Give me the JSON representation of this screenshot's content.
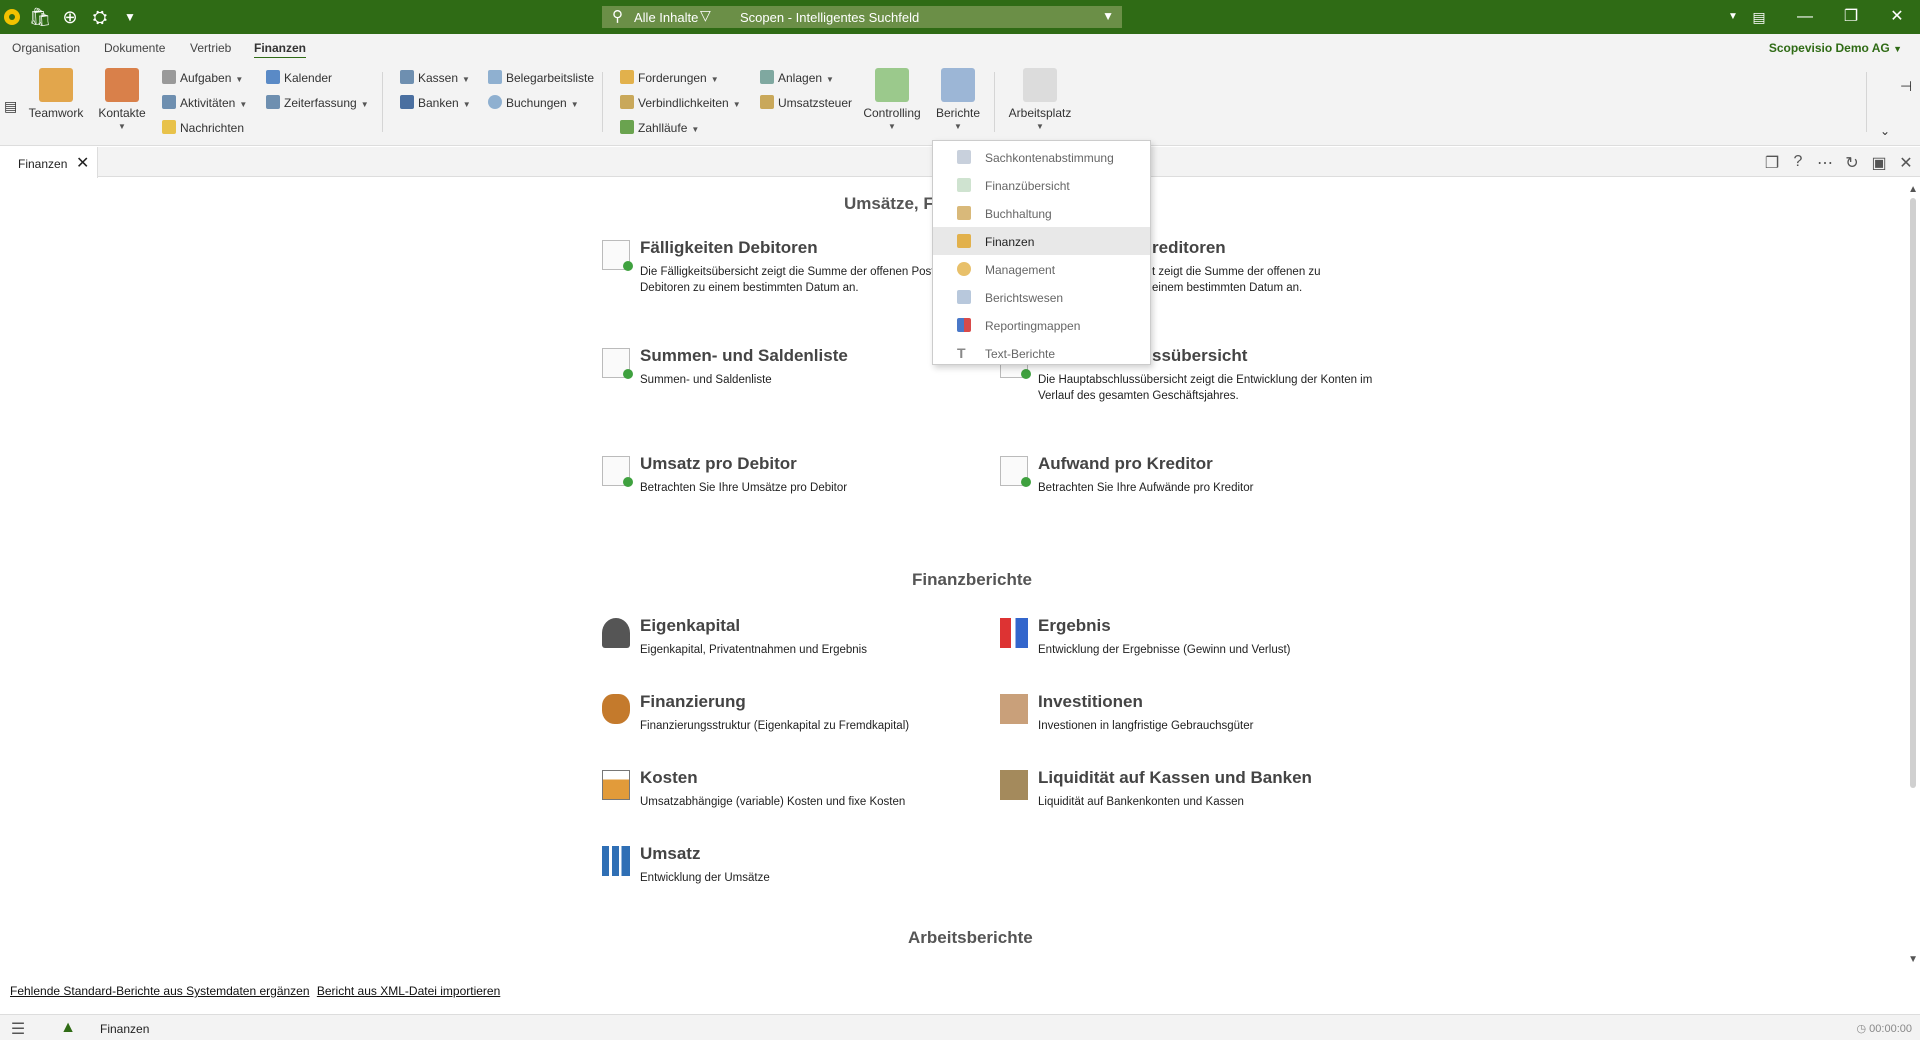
{
  "titlebar": {
    "search_filter": "Alle Inhalte",
    "search_placeholder": "Scopen - Intelligentes Suchfeld"
  },
  "menu": {
    "tabs": [
      "Organisation",
      "Dokumente",
      "Vertrieb",
      "Finanzen"
    ],
    "active_tab": "Finanzen",
    "company": "Scopevisio Demo AG"
  },
  "ribbon": {
    "teamwork": "Teamwork",
    "kontakte": "Kontakte",
    "aufgaben": "Aufgaben",
    "aktivitaeten": "Aktivitäten",
    "nachrichten": "Nachrichten",
    "kalender": "Kalender",
    "zeiterfassung": "Zeiterfassung",
    "kassen": "Kassen",
    "banken": "Banken",
    "belegarbeitsliste": "Belegarbeitsliste",
    "buchungen": "Buchungen",
    "forderungen": "Forderungen",
    "verbindlichkeiten": "Verbindlichkeiten",
    "zahllaeufe": "Zahlläufe",
    "anlagen": "Anlagen",
    "umsatzsteuer": "Umsatzsteuer",
    "controlling": "Controlling",
    "berichte": "Berichte",
    "arbeitsplatz": "Arbeitsplatz"
  },
  "doc_tab": {
    "label": "Finanzen"
  },
  "sections": {
    "umsaetze": "Umsätze, F",
    "finanzberichte": "Finanzberichte",
    "arbeitsberichte": "Arbeitsberichte"
  },
  "cards": {
    "faelligkeiten_debitoren": {
      "title": "Fälligkeiten Debitoren",
      "desc": "Die Fälligkeitsübersicht zeigt die Summe der offenen Posten der Debitoren zu einem bestimmten Datum an."
    },
    "faelligkeiten_kreditoren": {
      "title": "reditoren",
      "desc": "t zeigt die Summe der offenen zu einem bestimmten Datum an."
    },
    "summen_saldenliste": {
      "title": "Summen- und Saldenliste",
      "desc": "Summen- und Saldenliste"
    },
    "hauptabschluss": {
      "title": "ssübersicht",
      "desc": "Die Hauptabschlussübersicht zeigt die Entwicklung der Konten im Verlauf des gesamten Geschäftsjahres."
    },
    "umsatz_debitor": {
      "title": "Umsatz pro Debitor",
      "desc": "Betrachten Sie Ihre Umsätze pro Debitor"
    },
    "aufwand_kreditor": {
      "title": "Aufwand pro Kreditor",
      "desc": "Betrachten Sie Ihre Aufwände pro Kreditor"
    },
    "eigenkapital": {
      "title": "Eigenkapital",
      "desc": "Eigenkapital, Privatentnahmen und Ergebnis"
    },
    "ergebnis": {
      "title": "Ergebnis",
      "desc": "Entwicklung der Ergebnisse (Gewinn und Verlust)"
    },
    "finanzierung": {
      "title": "Finanzierung",
      "desc": "Finanzierungsstruktur (Eigenkapital zu Fremdkapital)"
    },
    "investitionen": {
      "title": "Investitionen",
      "desc": "Investionen in langfristige Gebrauchsgüter"
    },
    "kosten": {
      "title": "Kosten",
      "desc": "Umsatzabhängige (variable) Kosten und fixe Kosten"
    },
    "liquiditaet": {
      "title": "Liquidität auf Kassen und Banken",
      "desc": "Liquidität auf Bankenkonten und Kassen"
    },
    "umsatz": {
      "title": "Umsatz",
      "desc": "Entwicklung der Umsätze"
    }
  },
  "links": {
    "fehlende": "Fehlende Standard-Berichte aus Systemdaten ergänzen",
    "xml": "Bericht aus XML-Datei importieren"
  },
  "statusbar": {
    "label": "Finanzen",
    "timer": "00:00:00"
  },
  "dropdown": {
    "items": [
      "Sachkontenabstimmung",
      "Finanzübersicht",
      "Buchhaltung",
      "Finanzen",
      "Management",
      "Berichtswesen",
      "Reportingmappen",
      "Text-Berichte"
    ],
    "selected": "Finanzen"
  },
  "colors": {
    "brand_green": "#2f6b15",
    "accent_green": "#3fa13f"
  }
}
